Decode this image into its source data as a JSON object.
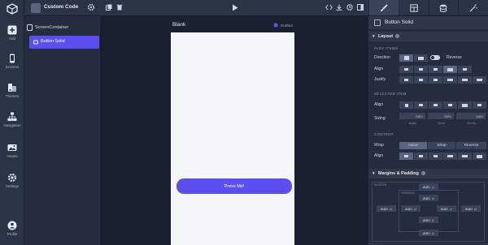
{
  "project": {
    "name": "Custom Code"
  },
  "rail": [
    {
      "label": "Add",
      "icon": "plus-icon"
    },
    {
      "label": "Screens",
      "icon": "phone-icon"
    },
    {
      "label": "Themes",
      "icon": "palette-icon"
    },
    {
      "label": "Navigation",
      "icon": "sitemap-icon"
    },
    {
      "label": "Assets",
      "icon": "image-icon"
    },
    {
      "label": "Settings",
      "icon": "gear-icon"
    },
    {
      "label": "Profile",
      "icon": "user-icon"
    }
  ],
  "tree": {
    "root": "ScreenContainer",
    "selected": "Button Solid"
  },
  "canvas": {
    "screen_title": "Blank",
    "status": "Drafted",
    "button_label": "Press Me!"
  },
  "props": {
    "title": "Button Solid",
    "layout": {
      "section": "Layout",
      "flex_items": "FLEX ITEMS",
      "direction_label": "Direction",
      "reverse_label": "Reverse",
      "align_label": "Align",
      "justify_label": "Justify",
      "selected_item": "SELECTED ITEM",
      "sel_align_label": "Align",
      "sizing_label": "Sizing",
      "sizing_values": [
        "auto",
        "auto",
        "auto"
      ],
      "sizing_captions": [
        "Basis",
        "Grow",
        "Shrink"
      ],
      "content": "CONTENT",
      "wrap_label": "Wrap",
      "wrap_options": [
        "None",
        "Wrap",
        "Reverse"
      ],
      "content_align_label": "Align"
    },
    "margins": {
      "section": "Margins & Padding",
      "margin_caption": "MARGIN",
      "padding_caption": "PADDING",
      "value": "auto",
      "unit": "pt"
    }
  },
  "colors": {
    "accent": "#5b4ff0",
    "panel": "#252c3e",
    "rail": "#2b3347"
  }
}
